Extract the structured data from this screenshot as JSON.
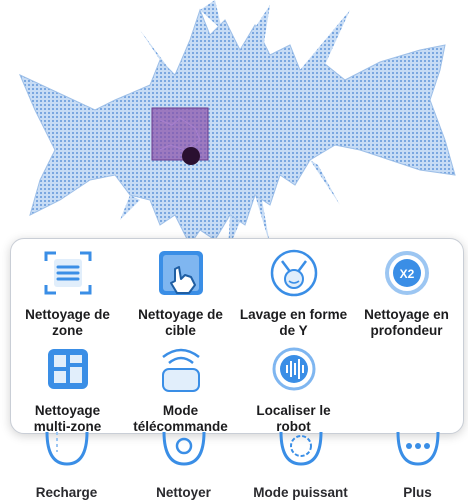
{
  "colors": {
    "accent": "#3a8ee6",
    "map_fill": "#b9d3f2",
    "map_dots": "#6f9fdc",
    "zone": "#8a4fa8",
    "robot": "#2a1030"
  },
  "map": {
    "icon": "cleaning-map"
  },
  "mode_panel": {
    "tiles": [
      {
        "label": "Nettoyage de\nzone",
        "icon": "zone-cleaning-icon"
      },
      {
        "label": "Nettoyage de\ncible",
        "icon": "target-cleaning-icon"
      },
      {
        "label": "Lavage en forme\nde Y",
        "icon": "y-shape-mopping-icon"
      },
      {
        "label": "Nettoyage en\nprofondeur",
        "icon": "deep-cleaning-icon"
      },
      {
        "label": "Nettoyage\nmulti-zone",
        "icon": "multi-zone-icon"
      },
      {
        "label": "Mode\ntélécommande",
        "icon": "remote-control-icon"
      },
      {
        "label": "Localiser le\nrobot",
        "icon": "locate-robot-icon"
      }
    ]
  },
  "bottom_bar": {
    "items": [
      {
        "label": "Recharge",
        "icon": "dock-icon"
      },
      {
        "label": "Nettoyer",
        "icon": "clean-icon"
      },
      {
        "label": "Mode puissant",
        "icon": "power-mode-icon"
      },
      {
        "label": "Plus",
        "icon": "more-icon"
      }
    ]
  }
}
